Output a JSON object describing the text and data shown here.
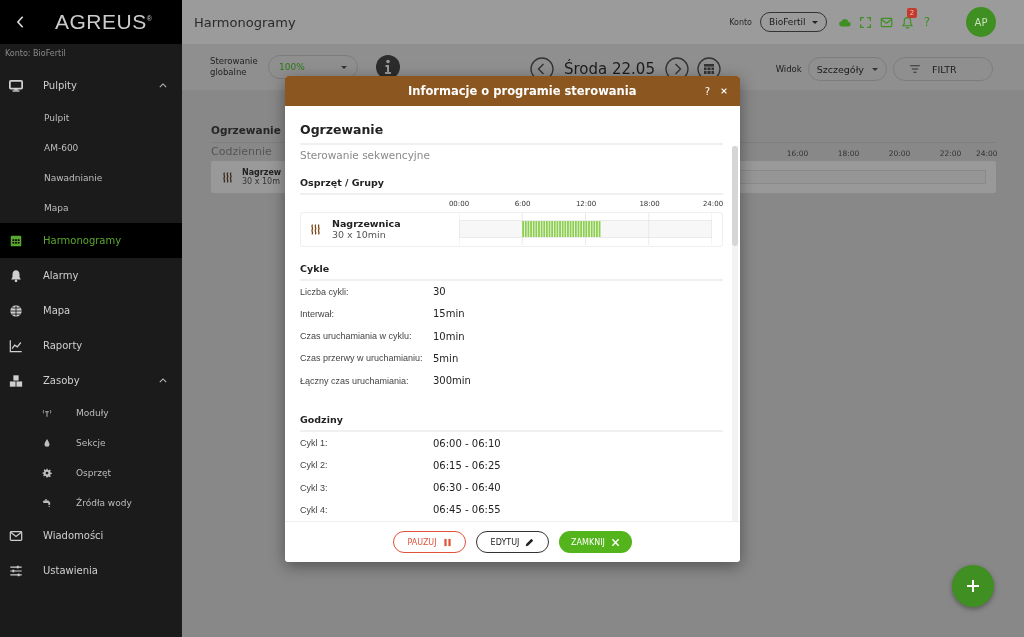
{
  "sidebar": {
    "logo": "AGREUS$^{®}$",
    "account": "Konto: BioFertil",
    "items": [
      {
        "label": "Pulpity",
        "selected": false,
        "expanded": true,
        "children": [
          {
            "label": "Pulpit",
            "selected": false
          },
          {
            "label": "AM-600",
            "selected": false
          },
          {
            "label": "Nawadnianie",
            "selected": false
          },
          {
            "label": "Mapa",
            "selected": false
          }
        ]
      },
      {
        "label": "Harmonogramy",
        "selected": true
      },
      {
        "label": "Alarmy",
        "selected": false
      },
      {
        "label": "Mapa",
        "selected": false
      },
      {
        "label": "Raporty",
        "selected": false
      },
      {
        "label": "Zasoby",
        "selected": false,
        "expanded": true,
        "children": [
          {
            "label": "Moduły",
            "selected": false
          },
          {
            "label": "Sekcje",
            "selected": false
          },
          {
            "label": "Osprzęt",
            "selected": false
          },
          {
            "label": "Źródła wody",
            "selected": false
          }
        ]
      },
      {
        "label": "Wiadomości",
        "selected": false
      },
      {
        "label": "Ustawienia",
        "selected": false
      }
    ]
  },
  "topbar": {
    "title": "Harmonogramy",
    "account_label": "Konto",
    "account": "BioFertil",
    "notifications": "2",
    "help": "?",
    "avatar": "AP"
  },
  "toolbar": {
    "global_label": "Sterowanie globalne",
    "global_value": "100%",
    "date": "Środa 22.05",
    "view_label": "Widok",
    "view": "Szczegóły",
    "filter": "FILTR"
  },
  "schedule": {
    "title": "Ogrzewanie",
    "repeat": "Codziennie",
    "device": "Nagrzew",
    "summary": "30 x 10m",
    "ticks": [
      "16:00",
      "18:00",
      "20:00",
      "22:00",
      "24:00"
    ]
  },
  "modal": {
    "title": "Informacje o programie sterowania",
    "help": "?",
    "program": "Ogrzewanie",
    "mode": "Sterowanie sekwencyjne",
    "devices_heading": "Osprzęt / Grupy",
    "ticks": [
      "00:00",
      "6:00",
      "12:00",
      "18:00",
      "24:00"
    ],
    "device": {
      "name": "Nagrzewnica",
      "summary": "30 x 10min"
    },
    "cycles_heading": "Cykle",
    "cycles": [
      {
        "label": "Liczba cykli:",
        "value": "30"
      },
      {
        "label": "Interwał:",
        "value": "15min"
      },
      {
        "label": "Czas uruchamiania w cyklu:",
        "value": "10min"
      },
      {
        "label": "Czas przerwy w uruchamianiu:",
        "value": "5min"
      },
      {
        "label": "Łączny czas uruchamiania:",
        "value": "300min"
      }
    ],
    "hours_heading": "Godziny",
    "hours": [
      {
        "label": "Cykl 1:",
        "value": "06:00 - 06:10"
      },
      {
        "label": "Cykl 2:",
        "value": "06:15 - 06:25"
      },
      {
        "label": "Cykl 3:",
        "value": "06:30 - 06:40"
      },
      {
        "label": "Cykl 4:",
        "value": "06:45 - 06:55"
      }
    ],
    "buttons": [
      {
        "label": "PAUZUJ",
        "kind": "pause"
      },
      {
        "label": "EDYTUJ",
        "kind": "edit"
      },
      {
        "label": "ZAMKNIJ",
        "kind": "close"
      }
    ]
  }
}
